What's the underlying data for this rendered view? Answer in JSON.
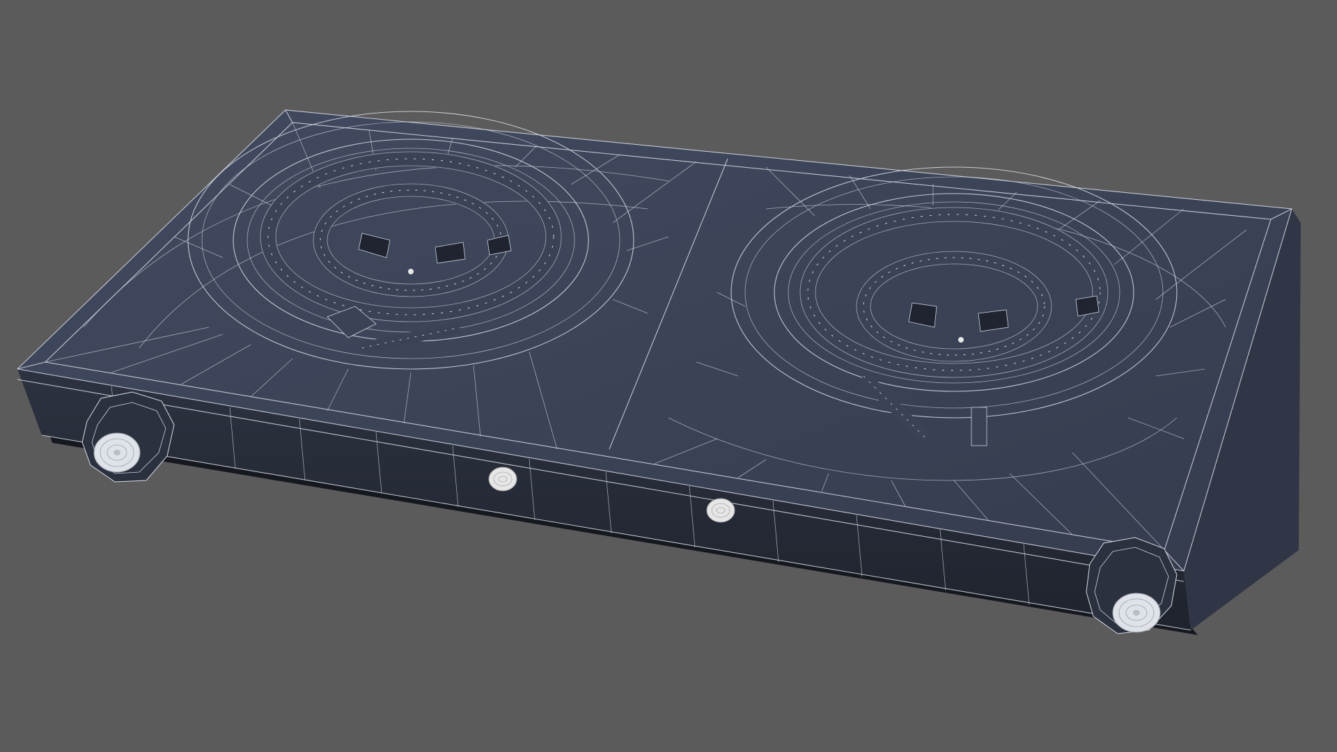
{
  "scene": {
    "background_color": "#5b5b5b",
    "object": "double-burner-hot-plate",
    "render_style": "wireframe-on-shaded",
    "colors": {
      "top_surface": "#3a4154",
      "front_face": "#262b37",
      "side_face": "#303646",
      "base": "#15181f",
      "wire": "#d9dde6",
      "knob": "#2c3140",
      "indicator_light": "#e6e6e6"
    },
    "burners": [
      {
        "name": "left-burner",
        "coil_turns": 2
      },
      {
        "name": "right-burner",
        "coil_turns": 2
      }
    ],
    "knobs": [
      {
        "name": "left-knob"
      },
      {
        "name": "right-knob"
      }
    ],
    "indicator_lights": [
      {
        "name": "left-indicator-light"
      },
      {
        "name": "right-indicator-light"
      }
    ]
  }
}
